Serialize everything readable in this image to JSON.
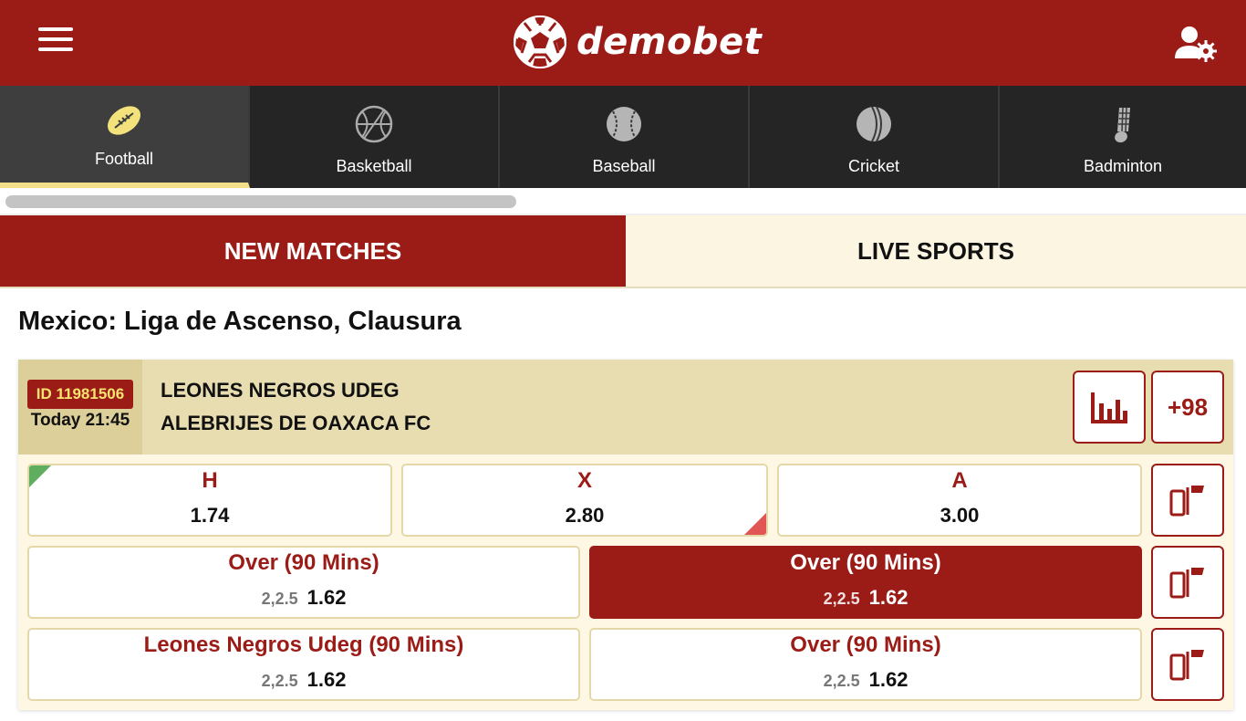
{
  "header": {
    "brand": "demobet",
    "icons": {
      "menu": "hamburger-icon",
      "logo": "soccer-ball-icon",
      "account": "user-settings-icon"
    },
    "colors": {
      "brand": "#9b1c17",
      "accent": "#f5e08a"
    }
  },
  "sports": [
    {
      "label": "Football",
      "icon": "football-icon",
      "active": true
    },
    {
      "label": "Basketball",
      "icon": "basketball-icon",
      "active": false
    },
    {
      "label": "Baseball",
      "icon": "baseball-icon",
      "active": false
    },
    {
      "label": "Cricket",
      "icon": "cricket-ball-icon",
      "active": false
    },
    {
      "label": "Badminton",
      "icon": "shuttlecock-icon",
      "active": false
    }
  ],
  "tabs": {
    "new_matches": "NEW MATCHES",
    "live_sports": "LIVE SPORTS",
    "active": "new_matches"
  },
  "league": {
    "title": "Mexico: Liga de Ascenso, Clausura"
  },
  "match": {
    "id_label": "ID 11981506",
    "time": "Today 21:45",
    "home_team": "LEONES NEGROS UDEG",
    "away_team": "ALEBRIJES DE OAXACA FC",
    "more_markets": "+98",
    "odds_1x2": [
      {
        "label": "H",
        "value": "1.74",
        "trend": "up"
      },
      {
        "label": "X",
        "value": "2.80",
        "trend": "down"
      },
      {
        "label": "A",
        "value": "3.00",
        "trend": "none"
      }
    ],
    "markets": [
      [
        {
          "label": "Over (90 Mins)",
          "line": "2,2.5",
          "value": "1.62",
          "selected": false
        },
        {
          "label": "Over (90 Mins)",
          "line": "2,2.5",
          "value": "1.62",
          "selected": true
        }
      ],
      [
        {
          "label": "Leones Negros Udeg (90 Mins)",
          "line": "2,2.5",
          "value": "1.62",
          "selected": false
        },
        {
          "label": "Over (90 Mins)",
          "line": "2,2.5",
          "value": "1.62",
          "selected": false
        }
      ]
    ],
    "icons": {
      "stats": "bar-chart-icon",
      "market_toggle": "market-switch-icon"
    }
  }
}
